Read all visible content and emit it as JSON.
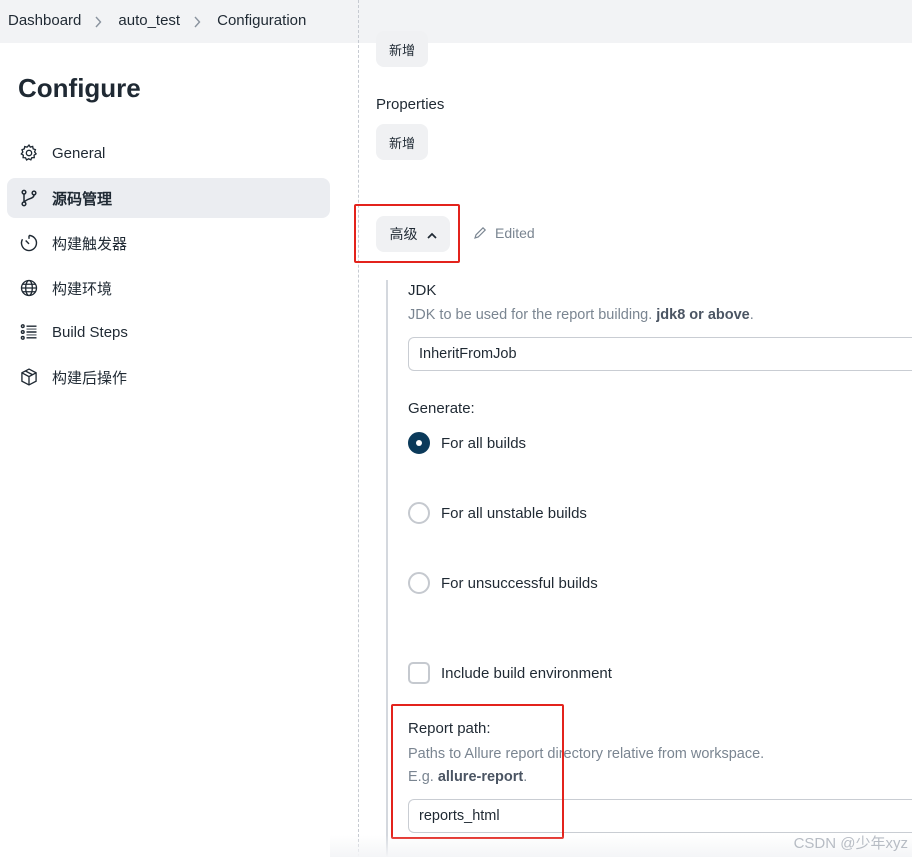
{
  "breadcrumb": {
    "items": [
      "Dashboard",
      "auto_test",
      "Configuration"
    ]
  },
  "sidebar": {
    "title": "Configure",
    "items": [
      {
        "label": "General",
        "icon": "gear-icon"
      },
      {
        "label": "源码管理",
        "icon": "branch-icon",
        "active": true
      },
      {
        "label": "构建触发器",
        "icon": "timer-icon"
      },
      {
        "label": "构建环境",
        "icon": "globe-icon"
      },
      {
        "label": "Build Steps",
        "icon": "list-icon"
      },
      {
        "label": "构建后操作",
        "icon": "package-icon"
      }
    ]
  },
  "main": {
    "add_button_1": "新增",
    "properties_label": "Properties",
    "add_button_2": "新增",
    "advanced_button": "高级",
    "edited_label": "Edited",
    "jdk": {
      "label": "JDK",
      "desc_prefix": "JDK to be used for the report building. ",
      "desc_bold": "jdk8 or above",
      "desc_suffix": ".",
      "value": "InheritFromJob"
    },
    "generate": {
      "label": "Generate:",
      "options": [
        {
          "label": "For all builds",
          "checked": true
        },
        {
          "label": "For all unstable builds",
          "checked": false
        },
        {
          "label": "For unsuccessful builds",
          "checked": false
        }
      ]
    },
    "include_env": {
      "label": "Include build environment",
      "checked": false
    },
    "report_path": {
      "label": "Report path:",
      "desc_line1": "Paths to Allure report directory relative from workspace.",
      "desc_line2_prefix": "E.g. ",
      "desc_line2_bold": "allure-report",
      "desc_line2_suffix": ".",
      "value": "reports_html"
    }
  },
  "watermark": "CSDN @少年xyz",
  "colors": {
    "highlight_box": "#e3231c",
    "radio_checked": "#0b3a5a",
    "active_item_bg": "#ebedf1"
  }
}
